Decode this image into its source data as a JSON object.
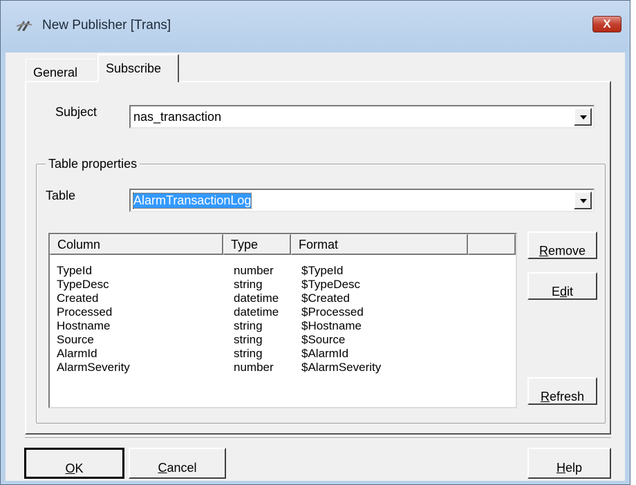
{
  "window": {
    "title": "New Publisher [Trans]",
    "close_label": "X"
  },
  "tabs": [
    {
      "label": "General"
    },
    {
      "label": "Subscribe"
    }
  ],
  "subject": {
    "label": "Subject",
    "value": "nas_transaction"
  },
  "table_properties": {
    "group_label": "Table properties",
    "table_label": "Table",
    "table_value": "AlarmTransactionLog"
  },
  "columns_list": {
    "headers": [
      "Column",
      "Type",
      "Format"
    ],
    "rows": [
      {
        "column": "TypeId",
        "type": "number",
        "format": "$TypeId"
      },
      {
        "column": "TypeDesc",
        "type": "string",
        "format": "$TypeDesc"
      },
      {
        "column": "Created",
        "type": "datetime",
        "format": "$Created"
      },
      {
        "column": "Processed",
        "type": "datetime",
        "format": "$Processed"
      },
      {
        "column": "Hostname",
        "type": "string",
        "format": "$Hostname"
      },
      {
        "column": "Source",
        "type": "string",
        "format": "$Source"
      },
      {
        "column": "AlarmId",
        "type": "string",
        "format": "$AlarmId"
      },
      {
        "column": "AlarmSeverity",
        "type": "number",
        "format": "$AlarmSeverity"
      }
    ]
  },
  "buttons": {
    "remove": {
      "accel": "R",
      "rest": "emove"
    },
    "edit": {
      "pre": "E",
      "accel": "d",
      "rest": "it"
    },
    "refresh": {
      "accel": "R",
      "rest": "efresh"
    },
    "ok": {
      "accel": "O",
      "rest": "K"
    },
    "cancel": {
      "accel": "C",
      "rest": "ancel"
    },
    "help": {
      "accel": "H",
      "rest": "elp"
    }
  }
}
